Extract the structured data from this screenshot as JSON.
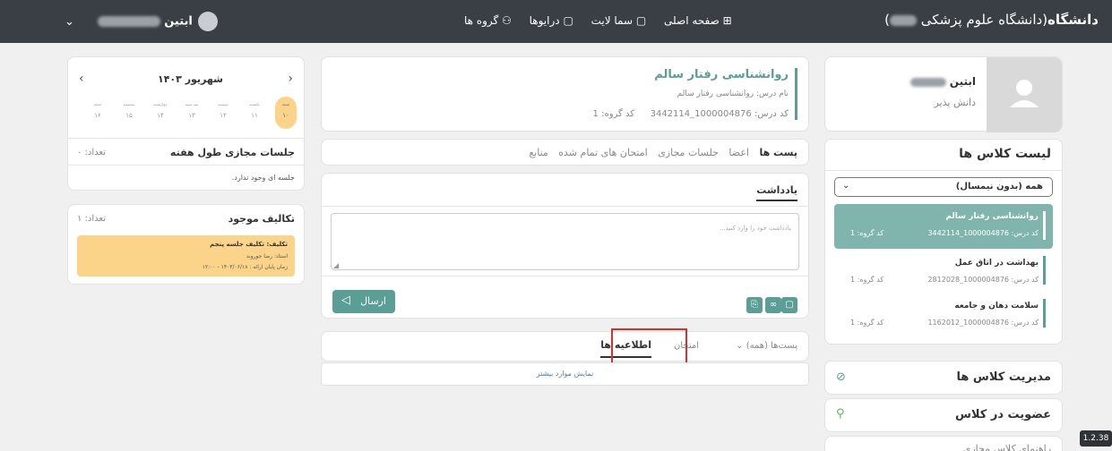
{
  "header": {
    "brand_bold": "دانشگاه",
    "brand_rest": "(دانشگاه علوم پزشکی",
    "brand_close": ")",
    "nav": [
      "صفحه اصلی",
      "سما لایت",
      "درایوها",
      "گروه ها"
    ],
    "user_name": "ابتین"
  },
  "profile": {
    "name": "ابتین",
    "role": "دانش پذیر"
  },
  "class_list": {
    "title": "لیست کلاس ها",
    "filter": "همه (بدون نیمسال)",
    "items": [
      {
        "name": "روانشناسی رفتار سالم",
        "code": "کد درس: 1000004876_3442114",
        "group": "کد گروه: 1"
      },
      {
        "name": "بهداشت در اتاق عمل",
        "code": "کد درس: 1000004876_2812028",
        "group": "کد گروه: 1"
      },
      {
        "name": "سلامت دهان و جامعه",
        "code": "کد درس: 1000004876_1162012",
        "group": "کد گروه: 1"
      }
    ]
  },
  "side_links": [
    "مدیریت کلاس ها",
    "عضویت در کلاس",
    "راهنمای کلاس مجازی"
  ],
  "version": "1.2.38",
  "course": {
    "title": "روانشناسی رفتار سالم",
    "subtitle": "نام درس: روانشناسی رفتار سالم",
    "code": "کد درس: 1000004876_3442114",
    "group": "کد گروه: 1"
  },
  "tabs": [
    "پست ها",
    "اعضا",
    "جلسات مجازی",
    "امتحان های تمام شده",
    "منابع"
  ],
  "note": {
    "title": "یادداشت",
    "placeholder": "یادداشت خود را وارد کنید...",
    "send": "ارسال"
  },
  "filter_tabs": [
    "پست‌ها (همه)",
    "امتحان",
    "اطلاعیه ها"
  ],
  "show_more": "نمایش موارد بیشتر",
  "calendar": {
    "month": "شهریور ۱۴۰۳",
    "days": [
      "شنبه",
      "یکشنبه",
      "دوشنبه",
      "سه شنبه",
      "چهارشنبه",
      "پنجشنبه",
      "جمعه"
    ],
    "dates": [
      "۱۰",
      "۱۱",
      "۱۲",
      "۱۳",
      "۱۴",
      "۱۵",
      "۱۶"
    ]
  },
  "sessions": {
    "title": "جلسات مجازی طول هفته",
    "count": "تعداد: ۰",
    "empty": "جلسه ای وجود ندارد."
  },
  "assignments": {
    "title": "تکالیف موجود",
    "count": "تعداد: ۱",
    "item_title": "تکلیف: تکلیف جلسه پنجم",
    "teacher": "استاد: رضا جوروند",
    "deadline": "زمان پایان ارائه : ۱۴۰۳/۰۶/۱۸ - ۱۲:۰۰"
  }
}
